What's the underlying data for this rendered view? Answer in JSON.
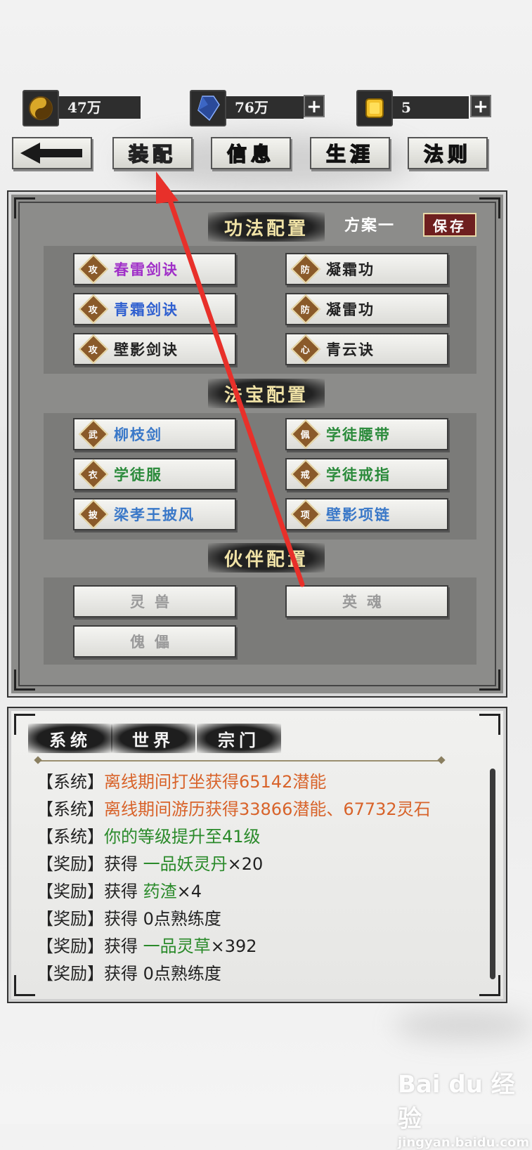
{
  "resources": [
    {
      "icon": "yin-yang-icon",
      "value": "47万",
      "has_plus": false
    },
    {
      "icon": "crystal-icon",
      "value": "76万",
      "has_plus": true
    },
    {
      "icon": "gold-ingot-icon",
      "value": "5",
      "has_plus": true
    }
  ],
  "nav": {
    "back_icon": "back-arrow-icon",
    "tabs": [
      "装配",
      "信息",
      "生涯",
      "法则"
    ],
    "active": "装配"
  },
  "skills": {
    "title": "功法配置",
    "scheme": "方案一",
    "save": "保存",
    "items": [
      {
        "tag": "攻",
        "name": "春雷剑诀",
        "color": "#a030c8"
      },
      {
        "tag": "防",
        "name": "凝霜功",
        "color": "#222222"
      },
      {
        "tag": "攻",
        "name": "青霜剑诀",
        "color": "#3060d0"
      },
      {
        "tag": "防",
        "name": "凝雷功",
        "color": "#222222"
      },
      {
        "tag": "攻",
        "name": "壁影剑诀",
        "color": "#222222"
      },
      {
        "tag": "心",
        "name": "青云诀",
        "color": "#222222"
      }
    ]
  },
  "treasures": {
    "title": "法宝配置",
    "items": [
      {
        "tag": "武",
        "name": "柳枝剑",
        "color": "#3a78c8"
      },
      {
        "tag": "佩",
        "name": "学徒腰带",
        "color": "#2a8a3a"
      },
      {
        "tag": "衣",
        "name": "学徒服",
        "color": "#2a8a3a"
      },
      {
        "tag": "戒",
        "name": "学徒戒指",
        "color": "#2a8a3a"
      },
      {
        "tag": "披",
        "name": "梁孝王披风",
        "color": "#3a78c8"
      },
      {
        "tag": "项",
        "name": "壁影项链",
        "color": "#3a78c8"
      }
    ]
  },
  "partners": {
    "title": "伙伴配置",
    "items": [
      "灵兽",
      "英魂",
      "傀儡"
    ]
  },
  "chat": {
    "tabs": [
      "系统",
      "世界",
      "宗门"
    ],
    "lines": [
      {
        "prefix": "【系统】",
        "segments": [
          {
            "text": "离线期间打坐获得65142潜能",
            "cls": "c-orange"
          }
        ]
      },
      {
        "prefix": "【系统】",
        "segments": [
          {
            "text": "离线期间游历获得33866潜能、67732灵石",
            "cls": "c-orange"
          }
        ]
      },
      {
        "prefix": "【系统】",
        "segments": [
          {
            "text": "你的等级提升至41级",
            "cls": "c-green"
          }
        ]
      },
      {
        "prefix": "【奖励】",
        "segments": [
          {
            "text": "获得 ",
            "cls": ""
          },
          {
            "text": "一品妖灵丹",
            "cls": "c-green"
          },
          {
            "text": "×20",
            "cls": ""
          }
        ]
      },
      {
        "prefix": "【奖励】",
        "segments": [
          {
            "text": "获得 ",
            "cls": ""
          },
          {
            "text": "药渣",
            "cls": "c-green"
          },
          {
            "text": "×4",
            "cls": ""
          }
        ]
      },
      {
        "prefix": "【奖励】",
        "segments": [
          {
            "text": "获得 0点熟练度",
            "cls": ""
          }
        ]
      },
      {
        "prefix": "【奖励】",
        "segments": [
          {
            "text": "获得 ",
            "cls": ""
          },
          {
            "text": "一品灵草",
            "cls": "c-green"
          },
          {
            "text": "×392",
            "cls": ""
          }
        ]
      },
      {
        "prefix": "【奖励】",
        "segments": [
          {
            "text": "获得 0点熟练度",
            "cls": ""
          }
        ]
      }
    ]
  },
  "watermark": {
    "brand": "Bai du 经验",
    "url": "jingyan.baidu.com"
  }
}
